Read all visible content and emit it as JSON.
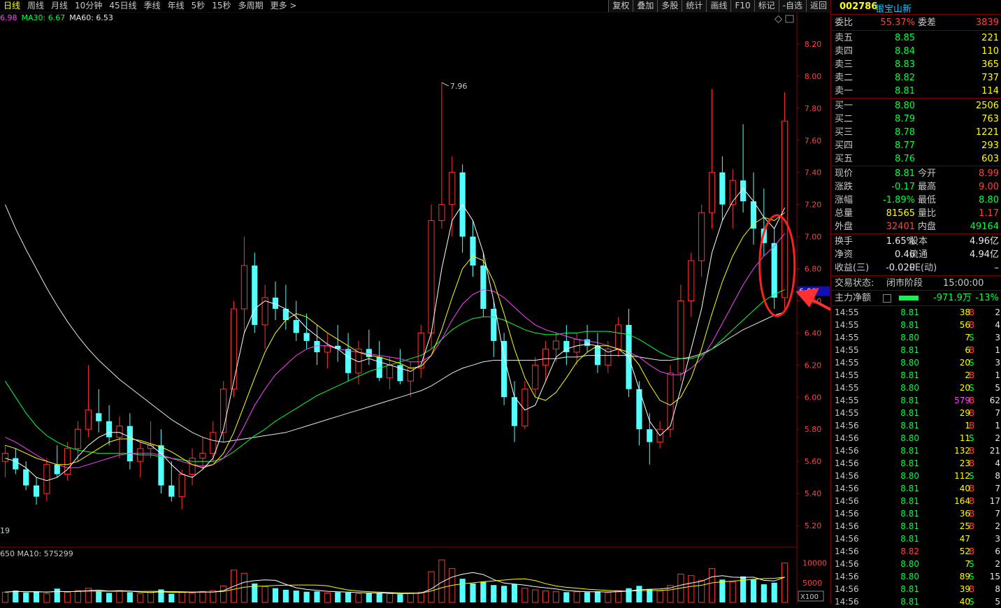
{
  "toolbar": {
    "periods": [
      "日线",
      "周线",
      "月线",
      "10分钟",
      "45日线",
      "季线",
      "年线",
      "5秒",
      "15秒",
      "多周期",
      "更多 >"
    ],
    "active_period": "日线",
    "tools": [
      "复权",
      "叠加",
      "多股",
      "统计",
      "画线",
      "F10",
      "标记",
      "-自选",
      "返回"
    ]
  },
  "ma_legend": {
    "items": [
      {
        "text": "6.98",
        "color": "#ff40ff"
      },
      {
        "text": "MA30: 6.67",
        "color": "#00ff40"
      },
      {
        "text": "MA60: 6.53",
        "color": "#e8e8e8"
      }
    ]
  },
  "stock": {
    "code": "002786",
    "name": "银宝山新"
  },
  "order_book": {
    "weibi_label": "委比",
    "weibi": "55.37%",
    "weicha_label": "委差",
    "weicha": "3839",
    "asks": [
      {
        "label": "卖五",
        "price": "8.85",
        "vol": "221"
      },
      {
        "label": "卖四",
        "price": "8.84",
        "vol": "110"
      },
      {
        "label": "卖三",
        "price": "8.83",
        "vol": "365"
      },
      {
        "label": "卖二",
        "price": "8.82",
        "vol": "737"
      },
      {
        "label": "卖一",
        "price": "8.81",
        "vol": "114"
      }
    ],
    "bids": [
      {
        "label": "买一",
        "price": "8.80",
        "vol": "2506"
      },
      {
        "label": "买二",
        "price": "8.79",
        "vol": "763"
      },
      {
        "label": "买三",
        "price": "8.78",
        "vol": "1221"
      },
      {
        "label": "买四",
        "price": "8.77",
        "vol": "293"
      },
      {
        "label": "买五",
        "price": "8.76",
        "vol": "603"
      }
    ]
  },
  "quote": [
    {
      "l1": "现价",
      "v1": "8.81",
      "c1": "green",
      "l2": "今开",
      "v2": "8.99",
      "c2": "red"
    },
    {
      "l1": "涨跌",
      "v1": "-0.17",
      "c1": "green",
      "l2": "最高",
      "v2": "9.00",
      "c2": "red"
    },
    {
      "l1": "涨幅",
      "v1": "-1.89%",
      "c1": "green",
      "l2": "最低",
      "v2": "8.80",
      "c2": "green"
    },
    {
      "l1": "总量",
      "v1": "81565",
      "c1": "yellow",
      "l2": "量比",
      "v2": "1.17",
      "c2": "red"
    },
    {
      "l1": "外盘",
      "v1": "32401",
      "c1": "red",
      "l2": "内盘",
      "v2": "49164",
      "c2": "green"
    }
  ],
  "fundamentals": [
    {
      "l1": "换手",
      "v1": "1.65%",
      "l2": "股本",
      "v2": "4.96亿"
    },
    {
      "l1": "净资",
      "v1": "0.46",
      "l2": "流通",
      "v2": "4.94亿"
    },
    {
      "l1": "收益(三)",
      "v1": "-0.020",
      "l2": "PE(动)",
      "v2": "–"
    }
  ],
  "status": {
    "label": "交易状态:",
    "value": "闭市阶段",
    "time": "15:00:00"
  },
  "main_force": {
    "label": "主力净额",
    "value": "-971.9万",
    "pct": "-13%"
  },
  "ticks": [
    {
      "t": "14:55",
      "p": "8.81",
      "pc": "green",
      "v": "38",
      "vc": "yellow",
      "d": "B",
      "n": "2"
    },
    {
      "t": "14:55",
      "p": "8.81",
      "pc": "green",
      "v": "56",
      "vc": "yellow",
      "d": "B",
      "n": "4"
    },
    {
      "t": "14:55",
      "p": "8.80",
      "pc": "green",
      "v": "7",
      "vc": "yellow",
      "d": "S",
      "n": "3"
    },
    {
      "t": "14:55",
      "p": "8.81",
      "pc": "green",
      "v": "6",
      "vc": "yellow",
      "d": "B",
      "n": "1"
    },
    {
      "t": "14:55",
      "p": "8.80",
      "pc": "green",
      "v": "20",
      "vc": "yellow",
      "d": "S",
      "n": "3"
    },
    {
      "t": "14:55",
      "p": "8.81",
      "pc": "green",
      "v": "2",
      "vc": "yellow",
      "d": "B",
      "n": "1"
    },
    {
      "t": "14:55",
      "p": "8.80",
      "pc": "green",
      "v": "20",
      "vc": "yellow",
      "d": "S",
      "n": "5"
    },
    {
      "t": "14:55",
      "p": "8.81",
      "pc": "green",
      "v": "579",
      "vc": "magenta",
      "d": "B",
      "n": "62"
    },
    {
      "t": "14:55",
      "p": "8.81",
      "pc": "green",
      "v": "29",
      "vc": "yellow",
      "d": "B",
      "n": "7"
    },
    {
      "t": "14:56",
      "p": "8.81",
      "pc": "green",
      "v": "1",
      "vc": "yellow",
      "d": "B",
      "n": "1"
    },
    {
      "t": "14:56",
      "p": "8.80",
      "pc": "green",
      "v": "11",
      "vc": "yellow",
      "d": "S",
      "n": "2"
    },
    {
      "t": "14:56",
      "p": "8.81",
      "pc": "green",
      "v": "132",
      "vc": "yellow",
      "d": "B",
      "n": "21"
    },
    {
      "t": "14:56",
      "p": "8.81",
      "pc": "green",
      "v": "23",
      "vc": "yellow",
      "d": "B",
      "n": "4"
    },
    {
      "t": "14:56",
      "p": "8.80",
      "pc": "green",
      "v": "112",
      "vc": "yellow",
      "d": "S",
      "n": "8"
    },
    {
      "t": "14:56",
      "p": "8.81",
      "pc": "green",
      "v": "40",
      "vc": "yellow",
      "d": "B",
      "n": "7"
    },
    {
      "t": "14:56",
      "p": "8.81",
      "pc": "green",
      "v": "164",
      "vc": "yellow",
      "d": "B",
      "n": "17"
    },
    {
      "t": "14:56",
      "p": "8.81",
      "pc": "green",
      "v": "36",
      "vc": "yellow",
      "d": "B",
      "n": "7"
    },
    {
      "t": "14:56",
      "p": "8.81",
      "pc": "green",
      "v": "25",
      "vc": "yellow",
      "d": "B",
      "n": "2"
    },
    {
      "t": "14:56",
      "p": "8.81",
      "pc": "green",
      "v": "47",
      "vc": "yellow",
      "d": "",
      "n": "3"
    },
    {
      "t": "14:56",
      "p": "8.82",
      "pc": "red",
      "v": "52",
      "vc": "yellow",
      "d": "B",
      "n": "6"
    },
    {
      "t": "14:56",
      "p": "8.80",
      "pc": "green",
      "v": "7",
      "vc": "yellow",
      "d": "S",
      "n": "2"
    },
    {
      "t": "14:56",
      "p": "8.80",
      "pc": "green",
      "v": "89",
      "vc": "yellow",
      "d": "S",
      "n": "15"
    },
    {
      "t": "14:56",
      "p": "8.81",
      "pc": "green",
      "v": "39",
      "vc": "yellow",
      "d": "B",
      "n": "8"
    },
    {
      "t": "14:56",
      "p": "8.81",
      "pc": "green",
      "v": "40",
      "vc": "yellow",
      "d": "S",
      "n": "5"
    }
  ],
  "chart_data": {
    "type": "candlestick",
    "price_axis": {
      "ticks": [
        "5.20",
        "5.40",
        "5.60",
        "5.80",
        "6.00",
        "6.20",
        "6.40",
        "6.60",
        "6.80",
        "7.00",
        "7.20",
        "7.40",
        "7.60",
        "7.80",
        "8.00",
        "8.20"
      ],
      "ylim": [
        5.1,
        8.3
      ]
    },
    "current_price_tag": "6.66",
    "bottom_left_label": "19",
    "peak_annotation": {
      "value": 7.96,
      "text": "7.96"
    },
    "volume_legend": "650  MA10: 575299",
    "volume_axis": {
      "ticks": [
        "5000",
        "10000"
      ],
      "unit_label": "X100",
      "max": 11000
    },
    "colors": {
      "up": "#ff3232",
      "down": "#54ffff",
      "ma_fast": "#ffffff",
      "ma_mid": "#ffff00",
      "ma_purple": "#ff40ff",
      "ma30": "#00ff40",
      "ma60": "#e8e8e8"
    },
    "candles": [
      [
        5.6,
        5.7,
        5.5,
        5.65
      ],
      [
        5.62,
        5.68,
        5.52,
        5.55
      ],
      [
        5.55,
        5.6,
        5.42,
        5.45
      ],
      [
        5.45,
        5.5,
        5.33,
        5.38
      ],
      [
        5.4,
        5.62,
        5.35,
        5.58
      ],
      [
        5.58,
        5.7,
        5.5,
        5.52
      ],
      [
        5.52,
        5.72,
        5.48,
        5.68
      ],
      [
        5.68,
        5.85,
        5.6,
        5.8
      ],
      [
        5.8,
        6.2,
        5.75,
        5.92
      ],
      [
        5.9,
        6.05,
        5.78,
        5.85
      ],
      [
        5.85,
        5.95,
        5.7,
        5.75
      ],
      [
        5.75,
        5.88,
        5.62,
        5.82
      ],
      [
        5.82,
        5.9,
        5.55,
        5.6
      ],
      [
        5.6,
        5.72,
        5.5,
        5.68
      ],
      [
        5.68,
        5.85,
        5.62,
        5.7
      ],
      [
        5.7,
        5.8,
        5.4,
        5.45
      ],
      [
        5.45,
        5.6,
        5.35,
        5.38
      ],
      [
        5.38,
        5.55,
        5.3,
        5.52
      ],
      [
        5.52,
        5.68,
        5.45,
        5.62
      ],
      [
        5.62,
        5.75,
        5.55,
        5.65
      ],
      [
        5.65,
        5.85,
        5.6,
        5.78
      ],
      [
        5.78,
        6.1,
        5.72,
        6.05
      ],
      [
        6.05,
        6.6,
        6.0,
        6.55
      ],
      [
        6.55,
        7.0,
        6.4,
        6.82
      ],
      [
        6.82,
        6.9,
        6.4,
        6.45
      ],
      [
        6.45,
        6.7,
        6.3,
        6.62
      ],
      [
        6.62,
        6.72,
        6.48,
        6.55
      ],
      [
        6.55,
        6.7,
        6.42,
        6.48
      ],
      [
        6.48,
        6.6,
        6.35,
        6.4
      ],
      [
        6.4,
        6.52,
        6.3,
        6.35
      ],
      [
        6.35,
        6.45,
        6.2,
        6.28
      ],
      [
        6.28,
        6.4,
        6.18,
        6.32
      ],
      [
        6.32,
        6.45,
        6.22,
        6.3
      ],
      [
        6.3,
        6.4,
        6.1,
        6.15
      ],
      [
        6.15,
        6.35,
        6.08,
        6.3
      ],
      [
        6.3,
        6.42,
        6.2,
        6.25
      ],
      [
        6.25,
        6.35,
        6.1,
        6.12
      ],
      [
        6.12,
        6.25,
        6.05,
        6.2
      ],
      [
        6.2,
        6.3,
        6.08,
        6.1
      ],
      [
        6.1,
        6.22,
        6.0,
        6.18
      ],
      [
        6.18,
        6.45,
        6.12,
        6.4
      ],
      [
        6.4,
        7.2,
        6.3,
        7.1
      ],
      [
        7.1,
        7.96,
        7.05,
        7.2
      ],
      [
        7.2,
        7.5,
        7.0,
        7.4
      ],
      [
        7.4,
        7.45,
        6.9,
        7.0
      ],
      [
        7.0,
        7.1,
        6.75,
        6.82
      ],
      [
        6.82,
        6.9,
        6.5,
        6.55
      ],
      [
        6.55,
        6.6,
        6.25,
        6.35
      ],
      [
        6.35,
        6.4,
        5.95,
        6.0
      ],
      [
        6.0,
        6.1,
        5.72,
        5.82
      ],
      [
        5.82,
        6.1,
        5.8,
        6.05
      ],
      [
        6.05,
        6.25,
        6.0,
        6.2
      ],
      [
        6.2,
        6.35,
        6.1,
        6.3
      ],
      [
        6.3,
        6.4,
        6.22,
        6.35
      ],
      [
        6.35,
        6.45,
        6.2,
        6.28
      ],
      [
        6.28,
        6.4,
        6.2,
        6.36
      ],
      [
        6.36,
        6.45,
        6.28,
        6.32
      ],
      [
        6.32,
        6.4,
        6.15,
        6.2
      ],
      [
        6.2,
        6.35,
        6.15,
        6.3
      ],
      [
        6.3,
        6.5,
        6.25,
        6.45
      ],
      [
        6.45,
        6.55,
        6.0,
        6.05
      ],
      [
        6.05,
        6.1,
        5.7,
        5.8
      ],
      [
        5.8,
        5.9,
        5.58,
        5.72
      ],
      [
        5.72,
        5.85,
        5.68,
        5.8
      ],
      [
        5.8,
        6.2,
        5.75,
        6.15
      ],
      [
        6.15,
        6.7,
        6.1,
        6.6
      ],
      [
        6.6,
        6.9,
        6.5,
        6.85
      ],
      [
        6.85,
        7.2,
        6.75,
        7.15
      ],
      [
        7.15,
        7.92,
        7.05,
        7.4
      ],
      [
        7.4,
        7.5,
        7.1,
        7.2
      ],
      [
        7.2,
        7.42,
        7.05,
        7.35
      ],
      [
        7.35,
        7.7,
        7.15,
        7.22
      ],
      [
        7.22,
        7.4,
        6.95,
        7.05
      ],
      [
        7.05,
        7.3,
        6.88,
        6.96
      ],
      [
        6.96,
        7.05,
        6.55,
        6.62
      ],
      [
        6.62,
        7.9,
        6.55,
        7.72
      ]
    ],
    "ma_fast": [
      5.62,
      5.6,
      5.56,
      5.5,
      5.48,
      5.5,
      5.55,
      5.63,
      5.7,
      5.75,
      5.78,
      5.78,
      5.75,
      5.72,
      5.7,
      5.65,
      5.58,
      5.52,
      5.5,
      5.55,
      5.62,
      5.8,
      6.1,
      6.4,
      6.55,
      6.6,
      6.58,
      6.55,
      6.5,
      6.43,
      6.38,
      6.33,
      6.3,
      6.25,
      6.22,
      6.24,
      6.22,
      6.2,
      6.18,
      6.16,
      6.2,
      6.4,
      6.8,
      7.1,
      7.2,
      7.1,
      6.9,
      6.6,
      6.25,
      6.0,
      5.92,
      5.95,
      6.1,
      6.25,
      6.3,
      6.32,
      6.33,
      6.32,
      6.28,
      6.3,
      6.25,
      6.05,
      5.85,
      5.76,
      5.82,
      6.05,
      6.3,
      6.55,
      6.9,
      7.1,
      7.22,
      7.3,
      7.22,
      7.12,
      7.05,
      7.18
    ],
    "ma_mid": [
      5.7,
      5.68,
      5.65,
      5.62,
      5.6,
      5.58,
      5.58,
      5.6,
      5.64,
      5.68,
      5.72,
      5.74,
      5.74,
      5.73,
      5.71,
      5.69,
      5.66,
      5.62,
      5.58,
      5.56,
      5.58,
      5.65,
      5.78,
      5.95,
      6.12,
      6.28,
      6.4,
      6.48,
      6.52,
      6.5,
      6.45,
      6.4,
      6.36,
      6.32,
      6.28,
      6.26,
      6.25,
      6.23,
      6.21,
      6.18,
      6.19,
      6.26,
      6.42,
      6.62,
      6.8,
      6.88,
      6.85,
      6.72,
      6.52,
      6.3,
      6.12,
      6.0,
      5.98,
      6.03,
      6.12,
      6.22,
      6.28,
      6.32,
      6.32,
      6.3,
      6.28,
      6.2,
      6.08,
      5.98,
      5.95,
      6.0,
      6.12,
      6.3,
      6.52,
      6.72,
      6.88,
      7.0,
      7.08,
      7.12,
      7.1,
      7.15
    ],
    "ma_purple": [
      5.75,
      5.72,
      5.68,
      5.64,
      5.6,
      5.58,
      5.56,
      5.56,
      5.58,
      5.6,
      5.62,
      5.64,
      5.65,
      5.65,
      5.65,
      5.64,
      5.62,
      5.6,
      5.58,
      5.57,
      5.58,
      5.62,
      5.7,
      5.82,
      5.95,
      6.05,
      6.14,
      6.2,
      6.26,
      6.3,
      6.32,
      6.32,
      6.3,
      6.29,
      6.28,
      6.27,
      6.26,
      6.25,
      6.24,
      6.22,
      6.22,
      6.26,
      6.36,
      6.48,
      6.58,
      6.64,
      6.67,
      6.66,
      6.62,
      6.56,
      6.5,
      6.45,
      6.42,
      6.4,
      6.38,
      6.36,
      6.35,
      6.34,
      6.32,
      6.3,
      6.28,
      6.25,
      6.2,
      6.16,
      6.14,
      6.14,
      6.18,
      6.24,
      6.34,
      6.46,
      6.58,
      6.7,
      6.8,
      6.88,
      6.94,
      7.02
    ],
    "ma30": [
      6.1,
      6.0,
      5.9,
      5.82,
      5.76,
      5.72,
      5.69,
      5.67,
      5.66,
      5.65,
      5.65,
      5.65,
      5.65,
      5.64,
      5.64,
      5.63,
      5.62,
      5.61,
      5.6,
      5.6,
      5.6,
      5.62,
      5.66,
      5.71,
      5.76,
      5.8,
      5.85,
      5.89,
      5.93,
      5.97,
      6.01,
      6.04,
      6.07,
      6.1,
      6.13,
      6.16,
      6.18,
      6.2,
      6.22,
      6.24,
      6.26,
      6.3,
      6.36,
      6.42,
      6.46,
      6.49,
      6.5,
      6.5,
      6.48,
      6.45,
      6.42,
      6.4,
      6.39,
      6.39,
      6.4,
      6.4,
      6.41,
      6.41,
      6.41,
      6.4,
      6.39,
      6.36,
      6.32,
      6.28,
      6.25,
      6.24,
      6.24,
      6.26,
      6.3,
      6.36,
      6.42,
      6.48,
      6.54,
      6.6,
      6.64,
      6.67
    ],
    "ma60": [
      7.2,
      7.05,
      6.92,
      6.8,
      6.68,
      6.57,
      6.47,
      6.38,
      6.3,
      6.23,
      6.17,
      6.11,
      6.06,
      6.01,
      5.96,
      5.91,
      5.86,
      5.82,
      5.78,
      5.75,
      5.73,
      5.72,
      5.73,
      5.74,
      5.75,
      5.76,
      5.77,
      5.78,
      5.8,
      5.82,
      5.84,
      5.86,
      5.88,
      5.9,
      5.92,
      5.94,
      5.96,
      5.98,
      6.0,
      6.02,
      6.04,
      6.07,
      6.11,
      6.15,
      6.18,
      6.2,
      6.22,
      6.23,
      6.23,
      6.23,
      6.23,
      6.23,
      6.24,
      6.24,
      6.25,
      6.25,
      6.26,
      6.26,
      6.26,
      6.26,
      6.26,
      6.25,
      6.24,
      6.23,
      6.23,
      6.24,
      6.25,
      6.27,
      6.3,
      6.34,
      6.38,
      6.42,
      6.45,
      6.48,
      6.51,
      6.53
    ],
    "volumes": [
      2600,
      3000,
      2500,
      2800,
      2200,
      3500,
      2600,
      3000,
      3600,
      2800,
      2400,
      3000,
      2600,
      2200,
      2500,
      3300,
      2200,
      2600,
      2400,
      2800,
      3000,
      4200,
      8200,
      7400,
      4800,
      4000,
      3600,
      3200,
      3000,
      2700,
      2800,
      2400,
      2600,
      2500,
      2200,
      2300,
      2400,
      2200,
      2100,
      2400,
      2600,
      7800,
      10800,
      8600,
      6000,
      4800,
      5200,
      4400,
      4200,
      4600,
      3600,
      3200,
      2900,
      2800,
      2600,
      2700,
      2600,
      2800,
      2500,
      3000,
      3600,
      4200,
      3400,
      2900,
      4300,
      7200,
      6800,
      5600,
      8600,
      5800,
      5200,
      6600,
      5800,
      4600,
      5000,
      10000
    ]
  }
}
